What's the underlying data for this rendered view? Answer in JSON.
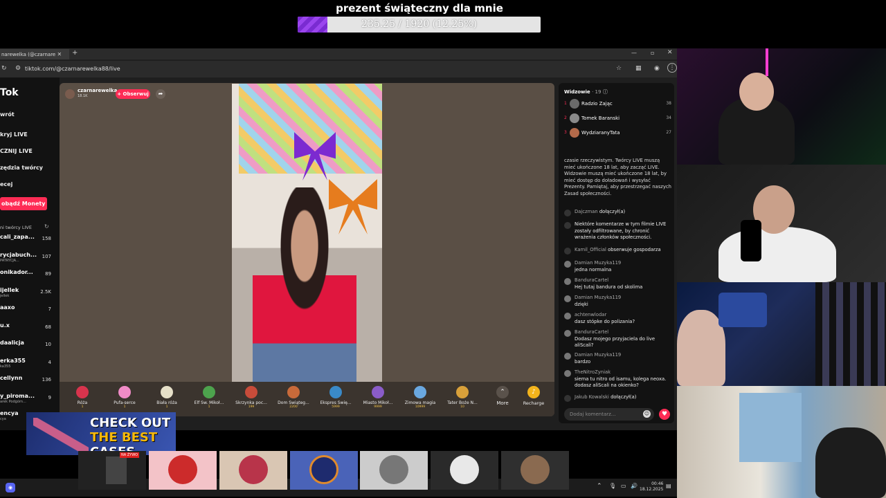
{
  "goal": {
    "title": "prezent świąteczny dla mnie",
    "progress_text": "235.25 / 1920 (12.25%)",
    "progress_fraction": 0.1225
  },
  "browser": {
    "tab_title": "narewelka (@czarnare",
    "url": "tiktok.com/@czarnarewelka88/live"
  },
  "sidebar": {
    "logo": "Tok",
    "nav": [
      "wrót",
      "kryj LIVE",
      "CZNIJ LIVE",
      "zędzia twórcy",
      "ecej"
    ],
    "coins_button": "obądź Monety",
    "section_title": "ni twórcy LIVE",
    "creators": [
      {
        "name": "cali_zapa...",
        "sub": "",
        "count": "158"
      },
      {
        "name": "rycjabuch...",
        "sub": "PATRYCJA...",
        "count": "107"
      },
      {
        "name": "onikador...",
        "sub": "",
        "count": "89"
      },
      {
        "name": "ijellek",
        "sub": "jellek",
        "count": "2.5K"
      },
      {
        "name": "aaxo",
        "sub": "",
        "count": "7"
      },
      {
        "name": "u.x",
        "sub": "",
        "count": "68"
      },
      {
        "name": "daalicja",
        "sub": "",
        "count": "10"
      },
      {
        "name": "erka355",
        "sub": "ka355",
        "count": "4"
      },
      {
        "name": "cellynn",
        "sub": "",
        "count": "136"
      },
      {
        "name": "y_piroma...",
        "sub": "arek Podgórn...",
        "count": "9"
      },
      {
        "name": "encya",
        "sub": "cya",
        "count": ""
      }
    ]
  },
  "live": {
    "host_name": "czarnarewelka",
    "host_likes": "18.1K",
    "follow_label": "+ Obserwuj",
    "share_icon": "share-arrow-icon",
    "gifts": [
      {
        "name": "Róża",
        "price": "1",
        "color": "#d8344d"
      },
      {
        "name": "Pufa-serce",
        "price": "1",
        "color": "#f08bc7"
      },
      {
        "name": "Biała róża",
        "price": "1",
        "color": "#e6e0c8"
      },
      {
        "name": "Elf Św. Mikoł...",
        "price": "1",
        "color": "#4da34d"
      },
      {
        "name": "Skrzynka poc...",
        "price": "199",
        "color": "#c84c3a"
      },
      {
        "name": "Dom Świąteg...",
        "price": "2200",
        "color": "#c86a3a"
      },
      {
        "name": "Ekspres Świę...",
        "price": "5999",
        "color": "#3a8ac8"
      },
      {
        "name": "Miasto Mikoł...",
        "price": "9999",
        "color": "#8a5cc8"
      },
      {
        "name": "Zimowa magia",
        "price": "10999",
        "color": "#6aa8e0"
      },
      {
        "name": "Tater Boże N...",
        "price": "10",
        "color": "#d8a03a"
      }
    ],
    "more_label": "More",
    "recharge_label": "Recharge"
  },
  "chat": {
    "viewers_title": "Widzowie",
    "viewers_count": "19",
    "top_viewers": [
      {
        "rank": "1",
        "name": "Radzio Zając",
        "score": "38"
      },
      {
        "rank": "2",
        "name": "Tomek Baranski",
        "score": "34"
      },
      {
        "rank": "3",
        "name": "WydziaranyTata",
        "score": "27"
      }
    ],
    "system_notice": "czasie rzeczywistym. Twórcy LIVE muszą mieć ukończone 18 lat, aby zacząć LIVE. Widzowie muszą mieć ukończone 18 lat, by mieć dostęp do doładowań i wysyłać Prezenty. Pamiętaj, aby przestrzegać naszych Zasad społeczności.",
    "join1_user": "Dajczman",
    "join1_action": "dołączył(a)",
    "filter_notice": "Niektóre komentarze w tym filmie LIVE zostały odfiltrowane, by chronić wrażenia członków społeczności.",
    "follow_user": "Kamil_Official",
    "follow_action": "obserwuje gospodarza",
    "messages": [
      {
        "user": "Damian Muzyka119",
        "text": "jedna normalna"
      },
      {
        "user": "BanduraCartel",
        "text": "Hej tutaj bandura od skolima"
      },
      {
        "user": "Damian Muzyka119",
        "text": "dzięki"
      },
      {
        "user": "achtenwlodar",
        "text": "dasz stópke do polizania?"
      },
      {
        "user": "BanduraCartel",
        "text": "Dodasz mojego przyjaciela do live aliScali?"
      },
      {
        "user": "Damian Muzyka119",
        "text": "bardzo"
      },
      {
        "user": "TheNitroZyniak",
        "text": "siema tu nitro od isamu, kolega neoxa. dodasz aliScali na okienko?"
      }
    ],
    "join2_user": "Jakub Kowalski",
    "join2_action": "dołączył(a)",
    "input_placeholder": "Dodaj komentarz..."
  },
  "taskbar": {
    "time": "00:46",
    "date": "18.12.2025"
  },
  "ad": {
    "line1": "CHECK OUT",
    "line2": "THE BEST",
    "line3": "CASES"
  },
  "thumbs": {
    "badge": "NA ŻYWO"
  }
}
